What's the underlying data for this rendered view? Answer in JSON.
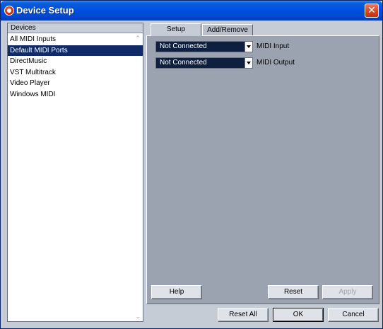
{
  "window": {
    "title": "Device Setup"
  },
  "devices": {
    "header": "Devices",
    "items": [
      {
        "label": "All MIDI Inputs"
      },
      {
        "label": "Default MIDI Ports",
        "selected": true
      },
      {
        "label": "DirectMusic"
      },
      {
        "label": "VST Multitrack"
      },
      {
        "label": "Video Player"
      },
      {
        "label": "Windows MIDI"
      }
    ]
  },
  "tabs": [
    {
      "label": "Setup",
      "active": true
    },
    {
      "label": "Add/Remove"
    }
  ],
  "settings": {
    "midi_input": {
      "value": "Not Connected",
      "label": "MIDI Input"
    },
    "midi_output": {
      "value": "Not Connected",
      "label": "MIDI Output"
    }
  },
  "panel_buttons": {
    "help": "Help",
    "reset": "Reset",
    "apply": "Apply"
  },
  "footer_buttons": {
    "reset_all": "Reset All",
    "ok": "OK",
    "cancel": "Cancel"
  },
  "colors": {
    "titlebar": "#0050e0",
    "selection": "#0f2a66",
    "panel": "#9ba3b0",
    "dialog": "#c5ccd6"
  }
}
